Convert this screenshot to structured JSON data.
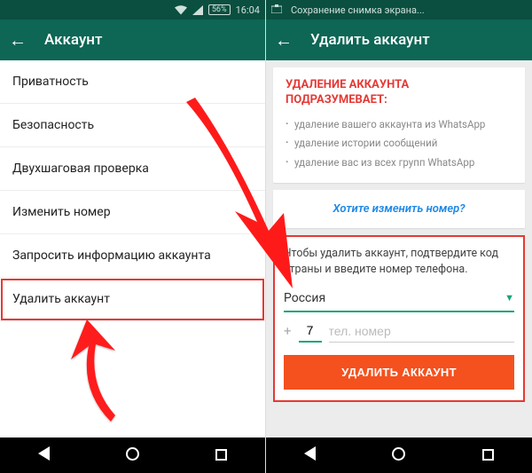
{
  "left": {
    "status": {
      "battery": "56%",
      "time": "16:04"
    },
    "actionbar": {
      "title": "Аккаунт"
    },
    "menu": [
      "Приватность",
      "Безопасность",
      "Двухшаговая проверка",
      "Изменить номер",
      "Запросить информацию аккаунта",
      "Удалить аккаунт"
    ]
  },
  "right": {
    "status": {
      "saving": "Сохранение снимка экрана..."
    },
    "actionbar": {
      "title": "Удалить аккаунт"
    },
    "warning": {
      "heading": "УДАЛЕНИЕ АККАУНТА ПОДРАЗУМЕВАЕТ:",
      "bullets": [
        "удаление вашего аккаунта из WhatsApp",
        "удаление истории сообщений",
        "удаление вас из всех групп WhatsApp"
      ]
    },
    "change_number": "Хотите изменить номер?",
    "confirm": {
      "text": "Чтобы удалить аккаунт, подтвердите код страны и введите номер телефона.",
      "country": "Россия",
      "plus": "+",
      "cc": "7",
      "phone_placeholder": "тел. номер",
      "button": "УДАЛИТЬ АККАУНТ"
    }
  }
}
